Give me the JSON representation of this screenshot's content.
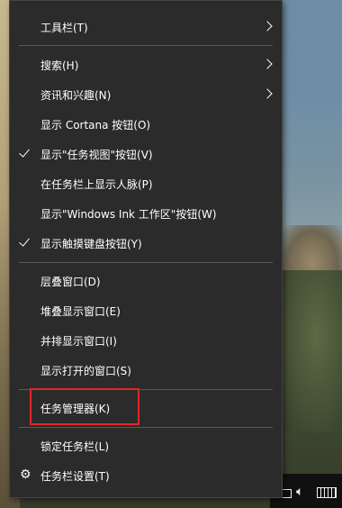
{
  "menu": {
    "items": [
      {
        "label": "工具栏(T)",
        "submenu": true
      },
      {
        "label": "搜索(H)",
        "submenu": true
      },
      {
        "label": "资讯和兴趣(N)",
        "submenu": true
      },
      {
        "label": "显示 Cortana 按钮(O)"
      },
      {
        "label": "显示\"任务视图\"按钮(V)",
        "checked": true
      },
      {
        "label": "在任务栏上显示人脉(P)"
      },
      {
        "label": "显示\"Windows Ink 工作区\"按钮(W)"
      },
      {
        "label": "显示触摸键盘按钮(Y)",
        "checked": true
      },
      {
        "label": "层叠窗口(D)"
      },
      {
        "label": "堆叠显示窗口(E)"
      },
      {
        "label": "并排显示窗口(I)"
      },
      {
        "label": "显示打开的窗口(S)"
      },
      {
        "label": "任务管理器(K)",
        "highlighted": true
      },
      {
        "label": "锁定任务栏(L)"
      },
      {
        "label": "任务栏设置(T)",
        "icon": "gear-icon"
      }
    ]
  },
  "colors": {
    "menu_bg": "#2b2b2b",
    "separator": "#5a5a5a",
    "highlight_border": "#e2262c",
    "text": "#ffffff"
  },
  "tray": {
    "icons": [
      "monitor-icon",
      "volume-icon",
      "keyboard-icon"
    ]
  }
}
